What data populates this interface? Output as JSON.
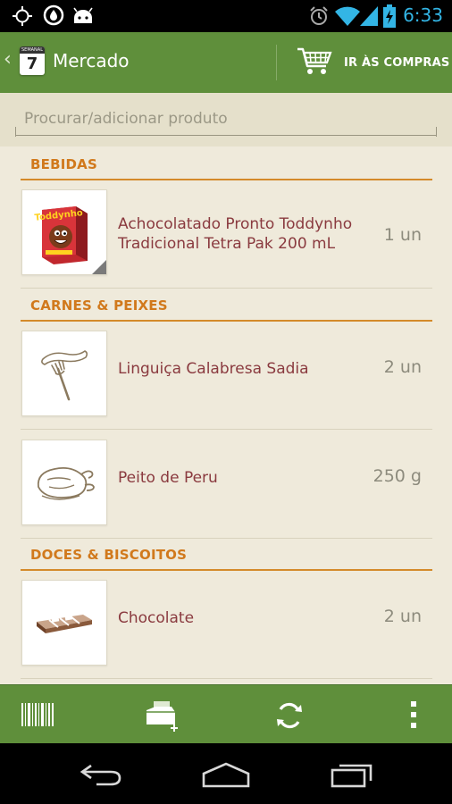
{
  "status_bar": {
    "time": "6:33",
    "icons": [
      "crosshair-icon",
      "drop-icon",
      "android-icon",
      "alarm-icon",
      "wifi-icon",
      "signal-icon",
      "battery-charging-icon"
    ]
  },
  "action_bar": {
    "title": "Mercado",
    "calendar_label": "SEMANAL",
    "calendar_day": "7",
    "cart_label": "IR ÀS COMPRAS"
  },
  "search": {
    "placeholder": "Procurar/adicionar produto",
    "value": ""
  },
  "sections": [
    {
      "title": "BEBIDAS",
      "items": [
        {
          "name": "Achocolatado Pronto Toddynho Tradicional Tetra Pak  200 mL",
          "qty": "1 un",
          "image": "toddynho-box-image",
          "brand_text": "Toddynho"
        }
      ]
    },
    {
      "title": "CARNES & PEIXES",
      "items": [
        {
          "name": "Linguiça Calabresa Sadia",
          "qty": "2 un",
          "image": "sausage-fork-icon"
        },
        {
          "name": "Peito de Peru",
          "qty": "250 g",
          "image": "roast-turkey-icon"
        }
      ]
    },
    {
      "title": "DOCES & BISCOITOS",
      "items": [
        {
          "name": "Chocolate",
          "qty": "2 un",
          "image": "chocolate-bar-icon"
        }
      ]
    }
  ],
  "bottom_bar": {
    "buttons": [
      "barcode-icon",
      "add-list-icon",
      "sync-icon",
      "overflow-menu-icon"
    ]
  },
  "nav_bar": {
    "buttons": [
      "back-icon",
      "home-icon",
      "recent-apps-icon"
    ]
  },
  "colors": {
    "action_bar": "#5f8f3b",
    "section_header": "#d1791c",
    "item_text": "#8a3a3f",
    "background": "#efeadb"
  }
}
